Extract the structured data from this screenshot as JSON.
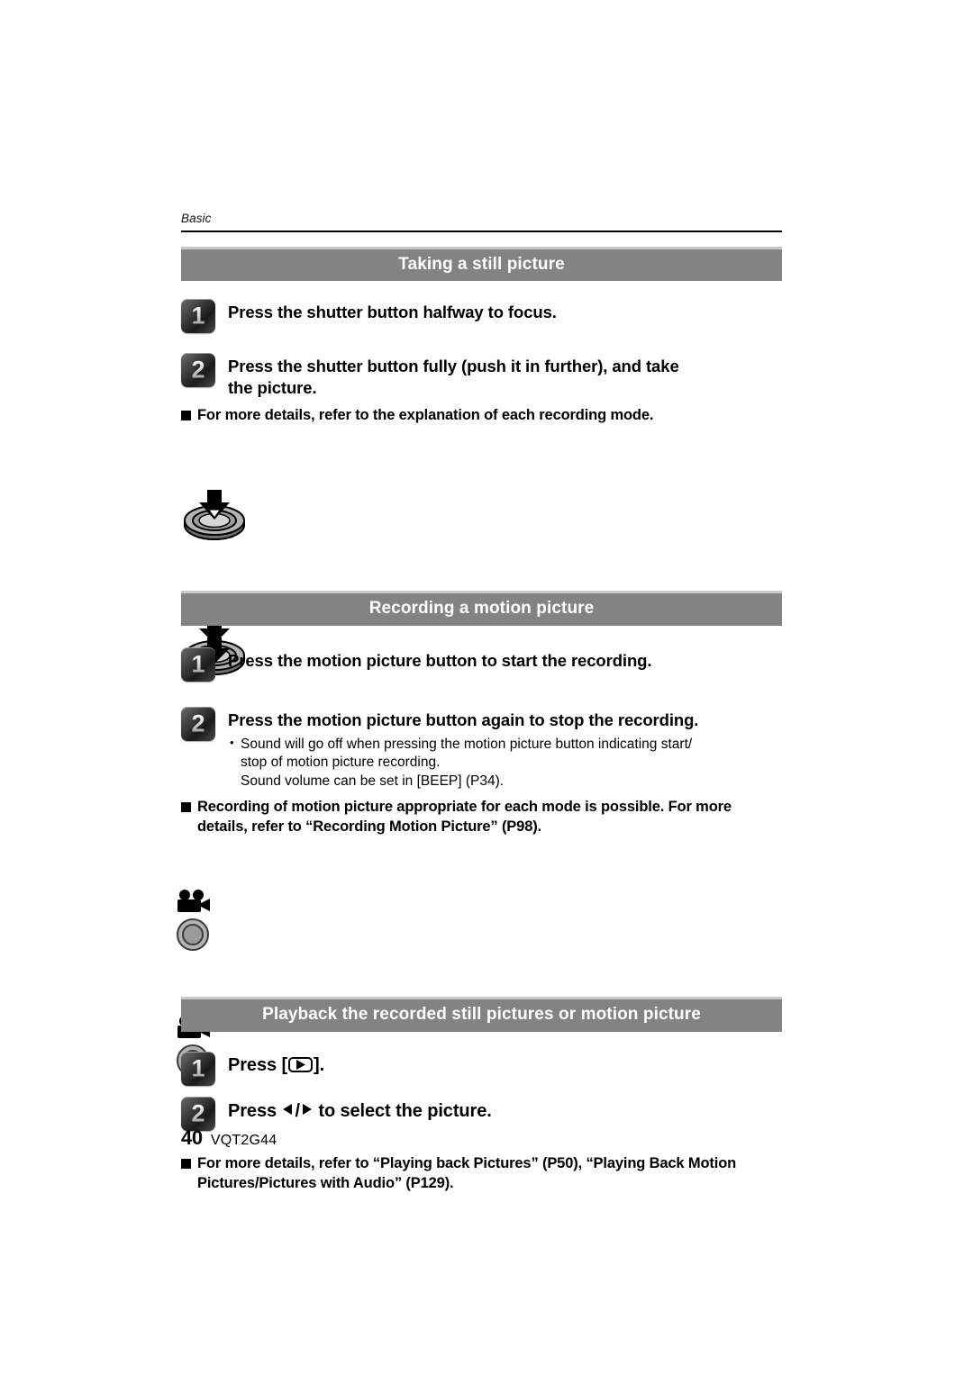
{
  "page": {
    "running_head": "Basic",
    "folio": "40",
    "doc_id": "VQT2G44"
  },
  "sections": [
    {
      "banner": "Taking a still picture",
      "steps": [
        {
          "number": "1",
          "title": "Press the shutter button halfway to focus.",
          "icon": "shutter-button-halfway-icon"
        },
        {
          "number": "2",
          "title": "Press the shutter button fully (push it in further), and take the picture.",
          "icon": "shutter-button-full-icon"
        }
      ],
      "notes": [
        "For more details, refer to the explanation of each recording mode."
      ]
    },
    {
      "banner": "Recording a motion picture",
      "steps": [
        {
          "number": "1",
          "title": "Press the motion picture button to start the recording.",
          "icon": "motion-picture-button-icon"
        },
        {
          "number": "2",
          "title": "Press the motion picture button again to stop the recording.",
          "icon": "motion-picture-button-icon",
          "sub_bullets": [
            {
              "line1": "Sound will go off when pressing the motion picture button indicating start/",
              "line2": "stop of motion picture recording.",
              "line3": "Sound volume can be set in [BEEP] (P34)."
            }
          ]
        }
      ],
      "notes": [
        "Recording of motion picture appropriate for each mode is possible. For more details, refer to “Recording Motion Picture” (P98)."
      ]
    },
    {
      "banner": "Playback the recorded still pictures or motion picture",
      "steps": [
        {
          "number": "1",
          "title_before": "Press [",
          "title_after": "].",
          "icon": "playback-key-icon"
        },
        {
          "number": "2",
          "title_before": "Press ",
          "title_mid": "/",
          "title_after": " to select the picture.",
          "icon": "left-right-arrow-keys-icon"
        }
      ],
      "notes": [
        "For more details, refer to “Playing back Pictures” (P50), “Playing Back Motion Pictures/Pictures with Audio” (P129)."
      ]
    }
  ],
  "colors": {
    "banner_bg": "#838383",
    "banner_top_edge": "#c9c9c9",
    "rule": "#000000",
    "text": "#000000",
    "banner_text": "#ffffff"
  }
}
